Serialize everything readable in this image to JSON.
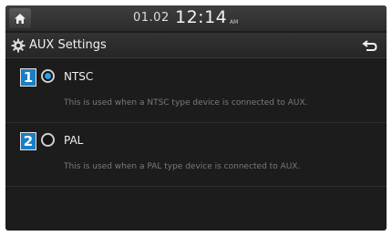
{
  "status_bar": {
    "date": "01.02",
    "time": "12:14",
    "ampm": "AM"
  },
  "header": {
    "title": "AUX Settings",
    "icons": {
      "home": "home-icon",
      "settings": "gear-icon",
      "back": "back-arrow-icon"
    }
  },
  "options": [
    {
      "number": "1",
      "label": "NTSC",
      "description": "This is used when a NTSC type device is connected to AUX.",
      "selected": true
    },
    {
      "number": "2",
      "label": "PAL",
      "description": "This is used when a PAL type device is connected to AUX.",
      "selected": false
    }
  ],
  "colors": {
    "accent": "#29a0e8",
    "badge": "#1a7ec6",
    "background": "#1c1c1c"
  }
}
